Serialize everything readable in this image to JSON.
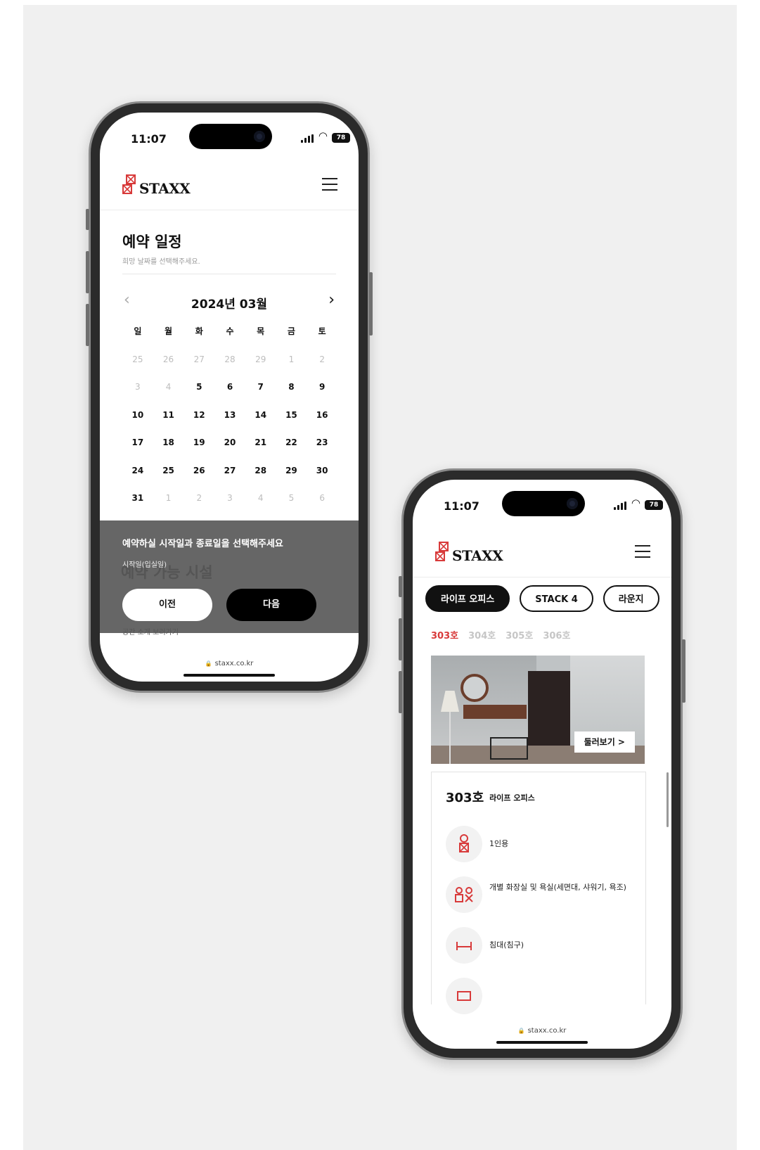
{
  "status": {
    "time": "11:07",
    "battery": "78"
  },
  "brand": {
    "name": "STAXX",
    "accent": "#d83a3a"
  },
  "url": "staxx.co.kr",
  "calendar_screen": {
    "title": "예약 일정",
    "subtitle": "희망 날짜를 선택해주세요.",
    "month_label": "2024년 03월",
    "weekdays": [
      "일",
      "월",
      "화",
      "수",
      "목",
      "금",
      "토"
    ],
    "weeks": [
      [
        "25",
        "26",
        "27",
        "28",
        "29",
        "1",
        "2"
      ],
      [
        "3",
        "4",
        "5",
        "6",
        "7",
        "8",
        "9"
      ],
      [
        "10",
        "11",
        "12",
        "13",
        "14",
        "15",
        "16"
      ],
      [
        "17",
        "18",
        "19",
        "20",
        "21",
        "22",
        "23"
      ],
      [
        "24",
        "25",
        "26",
        "27",
        "28",
        "29",
        "30"
      ],
      [
        "31",
        "1",
        "2",
        "3",
        "4",
        "5",
        "6"
      ]
    ],
    "muted_days": [
      [
        true,
        true,
        true,
        true,
        true,
        true,
        true
      ],
      [
        true,
        true,
        false,
        false,
        false,
        false,
        false
      ],
      [
        false,
        false,
        false,
        false,
        false,
        false,
        false
      ],
      [
        false,
        false,
        false,
        false,
        false,
        false,
        false
      ],
      [
        false,
        false,
        false,
        false,
        false,
        false,
        false
      ],
      [
        false,
        true,
        true,
        true,
        true,
        true,
        true
      ]
    ],
    "sheet": {
      "title": "예약하실 시작일과 종료일을 선택해주세요",
      "start_label": "시작일(입실일)",
      "behind_heading": "예약 가능 시설",
      "behind_text": "공간 소개 보러가기",
      "prev_button": "이전",
      "next_button": "다음"
    }
  },
  "room_screen": {
    "tabs": [
      {
        "label": "라이프 오피스",
        "active": true
      },
      {
        "label": "STACK 4",
        "active": false
      },
      {
        "label": "라운지",
        "active": false
      }
    ],
    "rooms": [
      {
        "label": "303호",
        "active": true
      },
      {
        "label": "304호",
        "active": false
      },
      {
        "label": "305호",
        "active": false
      },
      {
        "label": "306호",
        "active": false
      }
    ],
    "tour_button": "둘러보기 >",
    "card": {
      "room": "303호",
      "type": "라이프 오피스",
      "features": [
        {
          "icon": "person-icon",
          "text": "1인용"
        },
        {
          "icon": "two-persons-icon",
          "text": "개별 화장실 및 욕실(세면대, 샤워기, 욕조)"
        },
        {
          "icon": "bed-icon",
          "text": "침대(침구)"
        },
        {
          "icon": "desk-icon",
          "text": ""
        }
      ]
    }
  }
}
